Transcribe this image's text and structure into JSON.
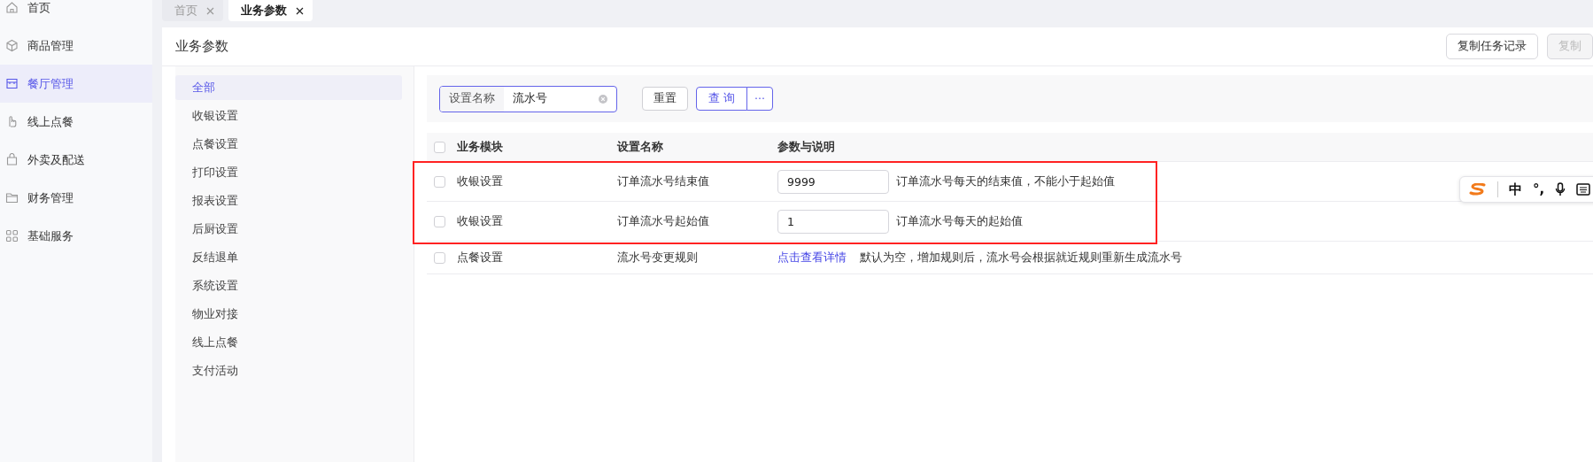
{
  "sidebar": {
    "items": [
      {
        "label": "首页",
        "selected": false
      },
      {
        "label": "商品管理",
        "selected": false
      },
      {
        "label": "餐厅管理",
        "selected": true
      },
      {
        "label": "线上点餐",
        "selected": false
      },
      {
        "label": "外卖及配送",
        "selected": false
      },
      {
        "label": "财务管理",
        "selected": false
      },
      {
        "label": "基础服务",
        "selected": false
      }
    ]
  },
  "tabs": [
    {
      "label": "首页",
      "selected": false
    },
    {
      "label": "业务参数",
      "selected": true
    }
  ],
  "page": {
    "title": "业务参数",
    "buttons": [
      {
        "label": "复制任务记录",
        "disabled": false
      },
      {
        "label": "复制",
        "disabled": true
      }
    ]
  },
  "categories": [
    {
      "label": "全部",
      "selected": true
    },
    {
      "label": "收银设置",
      "selected": false
    },
    {
      "label": "点餐设置",
      "selected": false
    },
    {
      "label": "打印设置",
      "selected": false
    },
    {
      "label": "报表设置",
      "selected": false
    },
    {
      "label": "后厨设置",
      "selected": false
    },
    {
      "label": "反结退单",
      "selected": false
    },
    {
      "label": "系统设置",
      "selected": false
    },
    {
      "label": "物业对接",
      "selected": false
    },
    {
      "label": "线上点餐",
      "selected": false
    },
    {
      "label": "支付活动",
      "selected": false
    }
  ],
  "filter": {
    "field_label": "设置名称",
    "value": "流水号",
    "buttons": [
      {
        "label": "重置",
        "kind": "default"
      },
      {
        "label": "查 询",
        "kind": "primary"
      },
      {
        "label": "···",
        "kind": "more"
      }
    ]
  },
  "table": {
    "columns": [
      "业务模块",
      "设置名称",
      "参数与说明"
    ],
    "all_checked": false,
    "rows": [
      {
        "checked": false,
        "highlighted": true,
        "module": "收银设置",
        "name": "订单流水号结束值",
        "kind": "input",
        "value": "9999",
        "description": "订单流水号每天的结束值，不能小于起始值"
      },
      {
        "checked": false,
        "highlighted": true,
        "module": "收银设置",
        "name": "订单流水号起始值",
        "kind": "input",
        "value": "1",
        "description": "订单流水号每天的起始值"
      },
      {
        "checked": false,
        "highlighted": false,
        "module": "点餐设置",
        "name": "流水号变更规则",
        "kind": "link",
        "value": "点击查看详情",
        "description": "默认为空，增加规则后，流水号会根据就近规则重新生成流水号"
      }
    ]
  },
  "ime": {
    "mode": "中",
    "punctuation": "°,"
  }
}
